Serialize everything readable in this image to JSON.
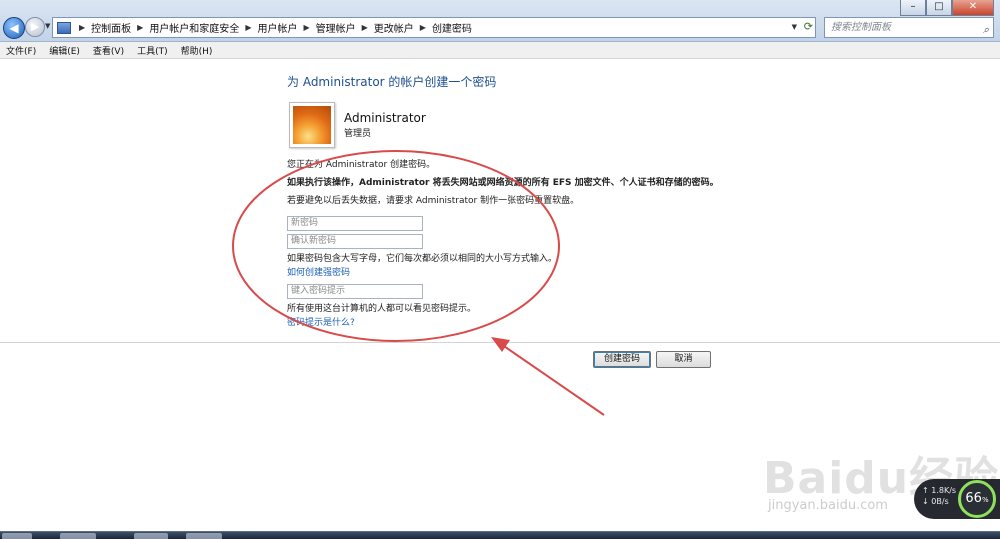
{
  "window": {
    "controls": {
      "minimize": "–",
      "maximize": "□",
      "close": "✕"
    }
  },
  "address_bar": {
    "crumbs": [
      "控制面板",
      "用户帐户和家庭安全",
      "用户帐户",
      "管理帐户",
      "更改帐户",
      "创建密码"
    ]
  },
  "search": {
    "placeholder": "搜索控制面板"
  },
  "menu": {
    "items": [
      "文件(F)",
      "编辑(E)",
      "查看(V)",
      "工具(T)",
      "帮助(H)"
    ]
  },
  "main": {
    "title": "为 Administrator 的帐户创建一个密码",
    "account": {
      "name": "Administrator",
      "role": "管理员"
    },
    "line_creating": "您正在为 Administrator 创建密码。",
    "warning": "如果执行该操作，Administrator 将丢失网站或网络资源的所有 EFS 加密文件、个人证书和存储的密码。",
    "reset_hint": "若要避免以后丢失数据，请要求 Administrator 制作一张密码重置软盘。",
    "new_password_placeholder": "新密码",
    "confirm_password_placeholder": "确认新密码",
    "case_note": "如果密码包含大写字母，它们每次都必须以相同的大小写方式输入。",
    "strong_password_link": "如何创建强密码",
    "hint_placeholder": "键入密码提示",
    "hint_visible_note": "所有使用这台计算机的人都可以看见密码提示。",
    "hint_what_link": "密码提示是什么?",
    "create_button": "创建密码",
    "cancel_button": "取消"
  },
  "annotation": {
    "color": "#d94a4a"
  },
  "watermark": {
    "logo": "Baidu经验",
    "url": "jingyan.baidu.com"
  },
  "net_meter": {
    "upload": "↑ 1.8K/s",
    "download": "↓ 0B/s",
    "percent": "66",
    "percent_unit": "%"
  }
}
